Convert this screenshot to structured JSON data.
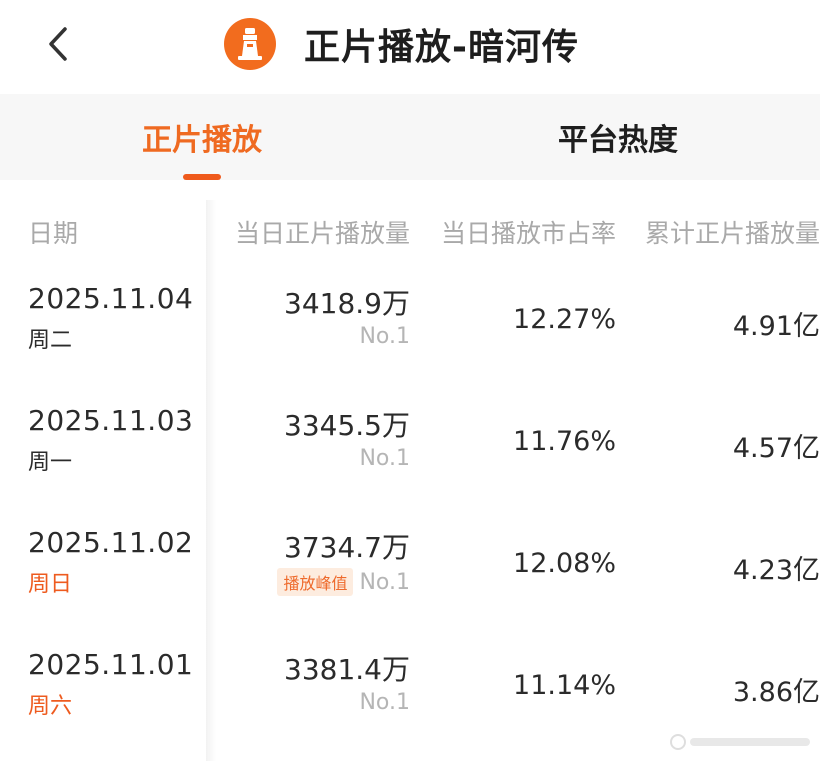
{
  "header": {
    "title": "正片播放-暗河传",
    "back_icon": "chevron-left-icon",
    "logo_icon": "lighthouse-icon",
    "logo_color": "#f26c1e"
  },
  "tabs": [
    {
      "label": "正片播放",
      "active": true
    },
    {
      "label": "平台热度",
      "active": false
    }
  ],
  "colors": {
    "accent": "#ef6a21",
    "weekend": "#ee5b1f",
    "muted": "#a9a9a9"
  },
  "table": {
    "columns": [
      "日期",
      "当日正片播放量",
      "当日播放市占率",
      "累计正片播放量"
    ],
    "rows": [
      {
        "date": "2025.11.04",
        "weekday": "周二",
        "weekend": false,
        "daily": "3418.9万",
        "rank": "No.1",
        "badge": "",
        "share": "12.27%",
        "total": "4.91亿"
      },
      {
        "date": "2025.11.03",
        "weekday": "周一",
        "weekend": false,
        "daily": "3345.5万",
        "rank": "No.1",
        "badge": "",
        "share": "11.76%",
        "total": "4.57亿"
      },
      {
        "date": "2025.11.02",
        "weekday": "周日",
        "weekend": true,
        "daily": "3734.7万",
        "rank": "No.1",
        "badge": "播放峰值",
        "share": "12.08%",
        "total": "4.23亿"
      },
      {
        "date": "2025.11.01",
        "weekday": "周六",
        "weekend": true,
        "daily": "3381.4万",
        "rank": "No.1",
        "badge": "",
        "share": "11.14%",
        "total": "3.86亿"
      }
    ]
  }
}
